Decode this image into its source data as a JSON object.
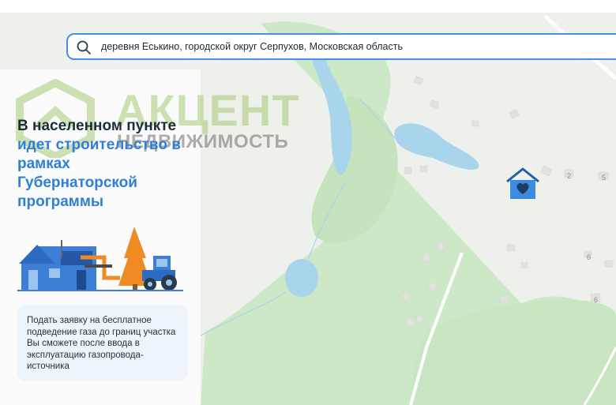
{
  "search": {
    "query": "деревня Еськино, городской округ Серпухов, Московская область"
  },
  "panel": {
    "title_part1": "В населенном пункте ",
    "title_part2": "идет строительство в рамках Губернаторской программы",
    "info_text": "Подать заявку на бесплатное подведение газа до границ участка Вы сможете после ввода в эксплуатацию газопровода-источника"
  },
  "watermark": {
    "line1": "АКЦЕНТ",
    "line2": "НЕДВИЖИМОСТЬ"
  },
  "map": {
    "house_numbers": [
      "2",
      "5",
      "6",
      "6"
    ],
    "pin_icon": "house-heart-icon"
  },
  "colors": {
    "accent": "#2f7fd6",
    "search_border": "#4a90e2",
    "map_green": "#c9e6c3",
    "water": "#a8d4ec"
  }
}
